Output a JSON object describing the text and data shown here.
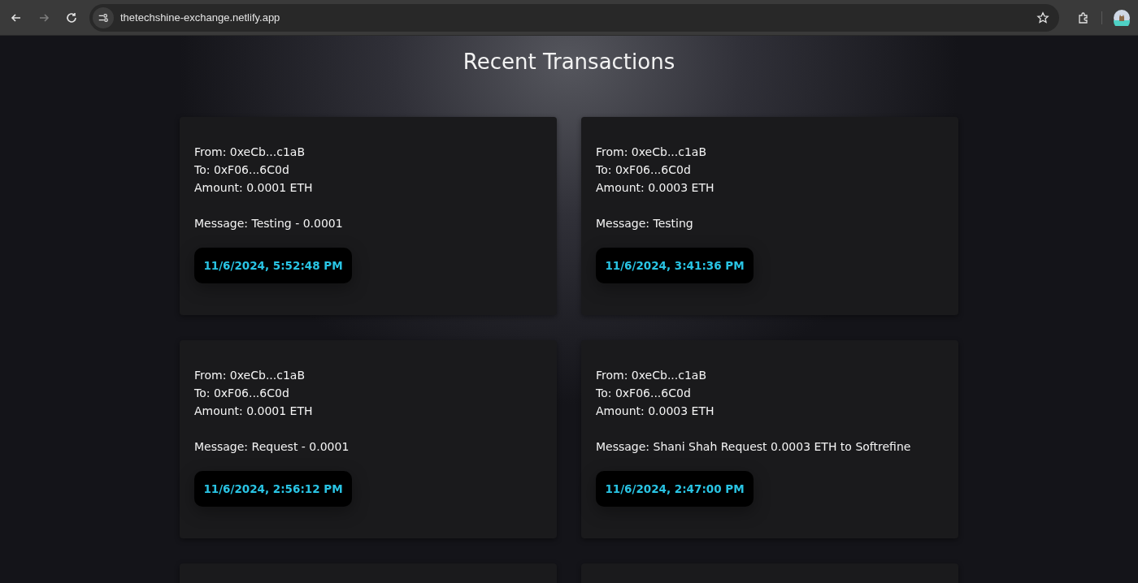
{
  "browser": {
    "url": "thetechshine-exchange.netlify.app"
  },
  "page": {
    "title": "Recent Transactions"
  },
  "transactions": [
    {
      "from": "From: 0xeCb...c1aB",
      "to": "To: 0xF06...6C0d",
      "amount": "Amount: 0.0001 ETH",
      "message": "Message: Testing - 0.0001",
      "timestamp": "11/6/2024, 5:52:48 PM"
    },
    {
      "from": "From: 0xeCb...c1aB",
      "to": "To: 0xF06...6C0d",
      "amount": "Amount: 0.0003 ETH",
      "message": "Message: Testing",
      "timestamp": "11/6/2024, 3:41:36 PM"
    },
    {
      "from": "From: 0xeCb...c1aB",
      "to": "To: 0xF06...6C0d",
      "amount": "Amount: 0.0001 ETH",
      "message": "Message: Request - 0.0001",
      "timestamp": "11/6/2024, 2:56:12 PM"
    },
    {
      "from": "From: 0xeCb...c1aB",
      "to": "To: 0xF06...6C0d",
      "amount": "Amount: 0.0003 ETH",
      "message": "Message: Shani Shah Request 0.0003 ETH to Softrefine",
      "timestamp": "11/6/2024, 2:47:00 PM"
    },
    {
      "cut_off": true
    },
    {
      "cut_off": true
    }
  ]
}
